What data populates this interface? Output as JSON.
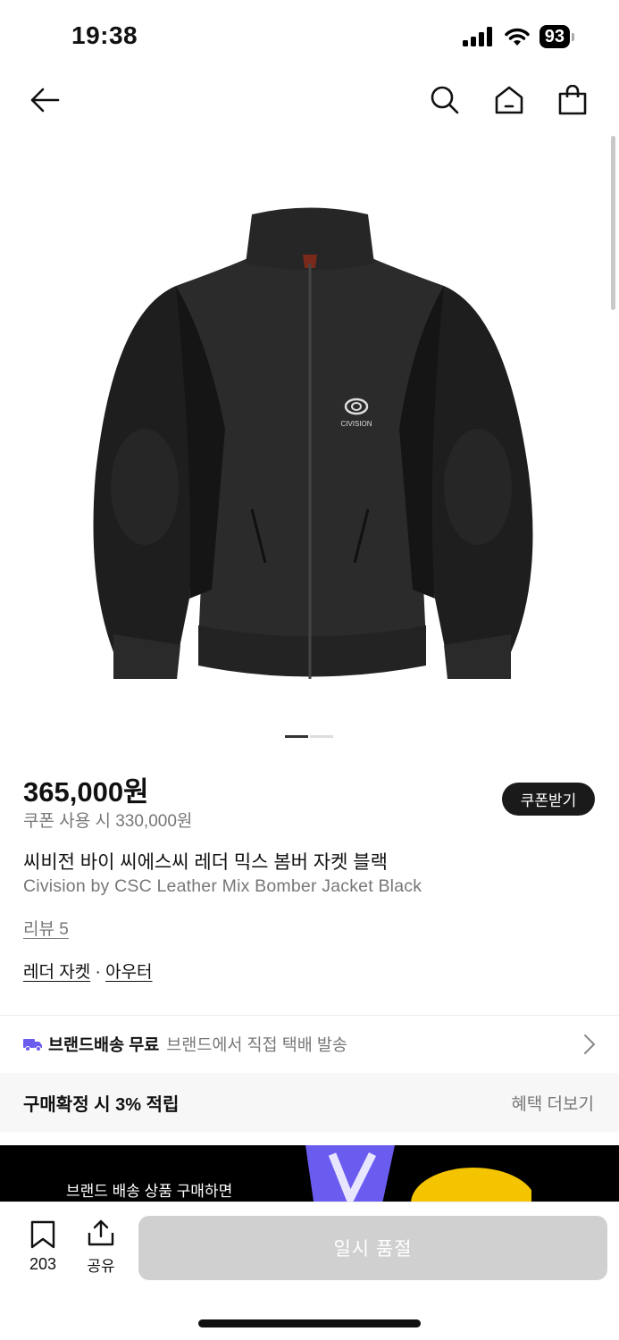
{
  "status_bar": {
    "time": "19:38",
    "battery": "93"
  },
  "nav": {
    "icons": [
      "back-arrow-icon",
      "search-icon",
      "home-icon",
      "shopping-bag-icon"
    ]
  },
  "product": {
    "price": "365,000원",
    "coupon_price": "쿠폰 사용 시 330,000원",
    "coupon_button": "쿠폰받기",
    "title_ko": "씨비전 바이 씨에스씨 레더 믹스 봄버 자켓 블랙",
    "title_en": "Civision by CSC Leather Mix Bomber Jacket Black",
    "review": "리뷰 5",
    "category_1": "레더 자켓",
    "category_sep": " · ",
    "category_2": "아우터",
    "jacket_logo_text": "CIVISION"
  },
  "shipping": {
    "main": "브랜드배송 무료",
    "sub": "브랜드에서 직접 택배 발송"
  },
  "benefit": {
    "text": "구매확정 시 3% 적립",
    "more": "혜택 더보기"
  },
  "banner": {
    "text": "브랜드 배송 상품 구매하면"
  },
  "bottom": {
    "bookmark_count": "203",
    "share_label": "공유",
    "soldout_button": "일시 품절"
  },
  "colors": {
    "accent_truck": "#6b5cf0",
    "dark": "#1a1a1a",
    "muted": "#777777"
  }
}
